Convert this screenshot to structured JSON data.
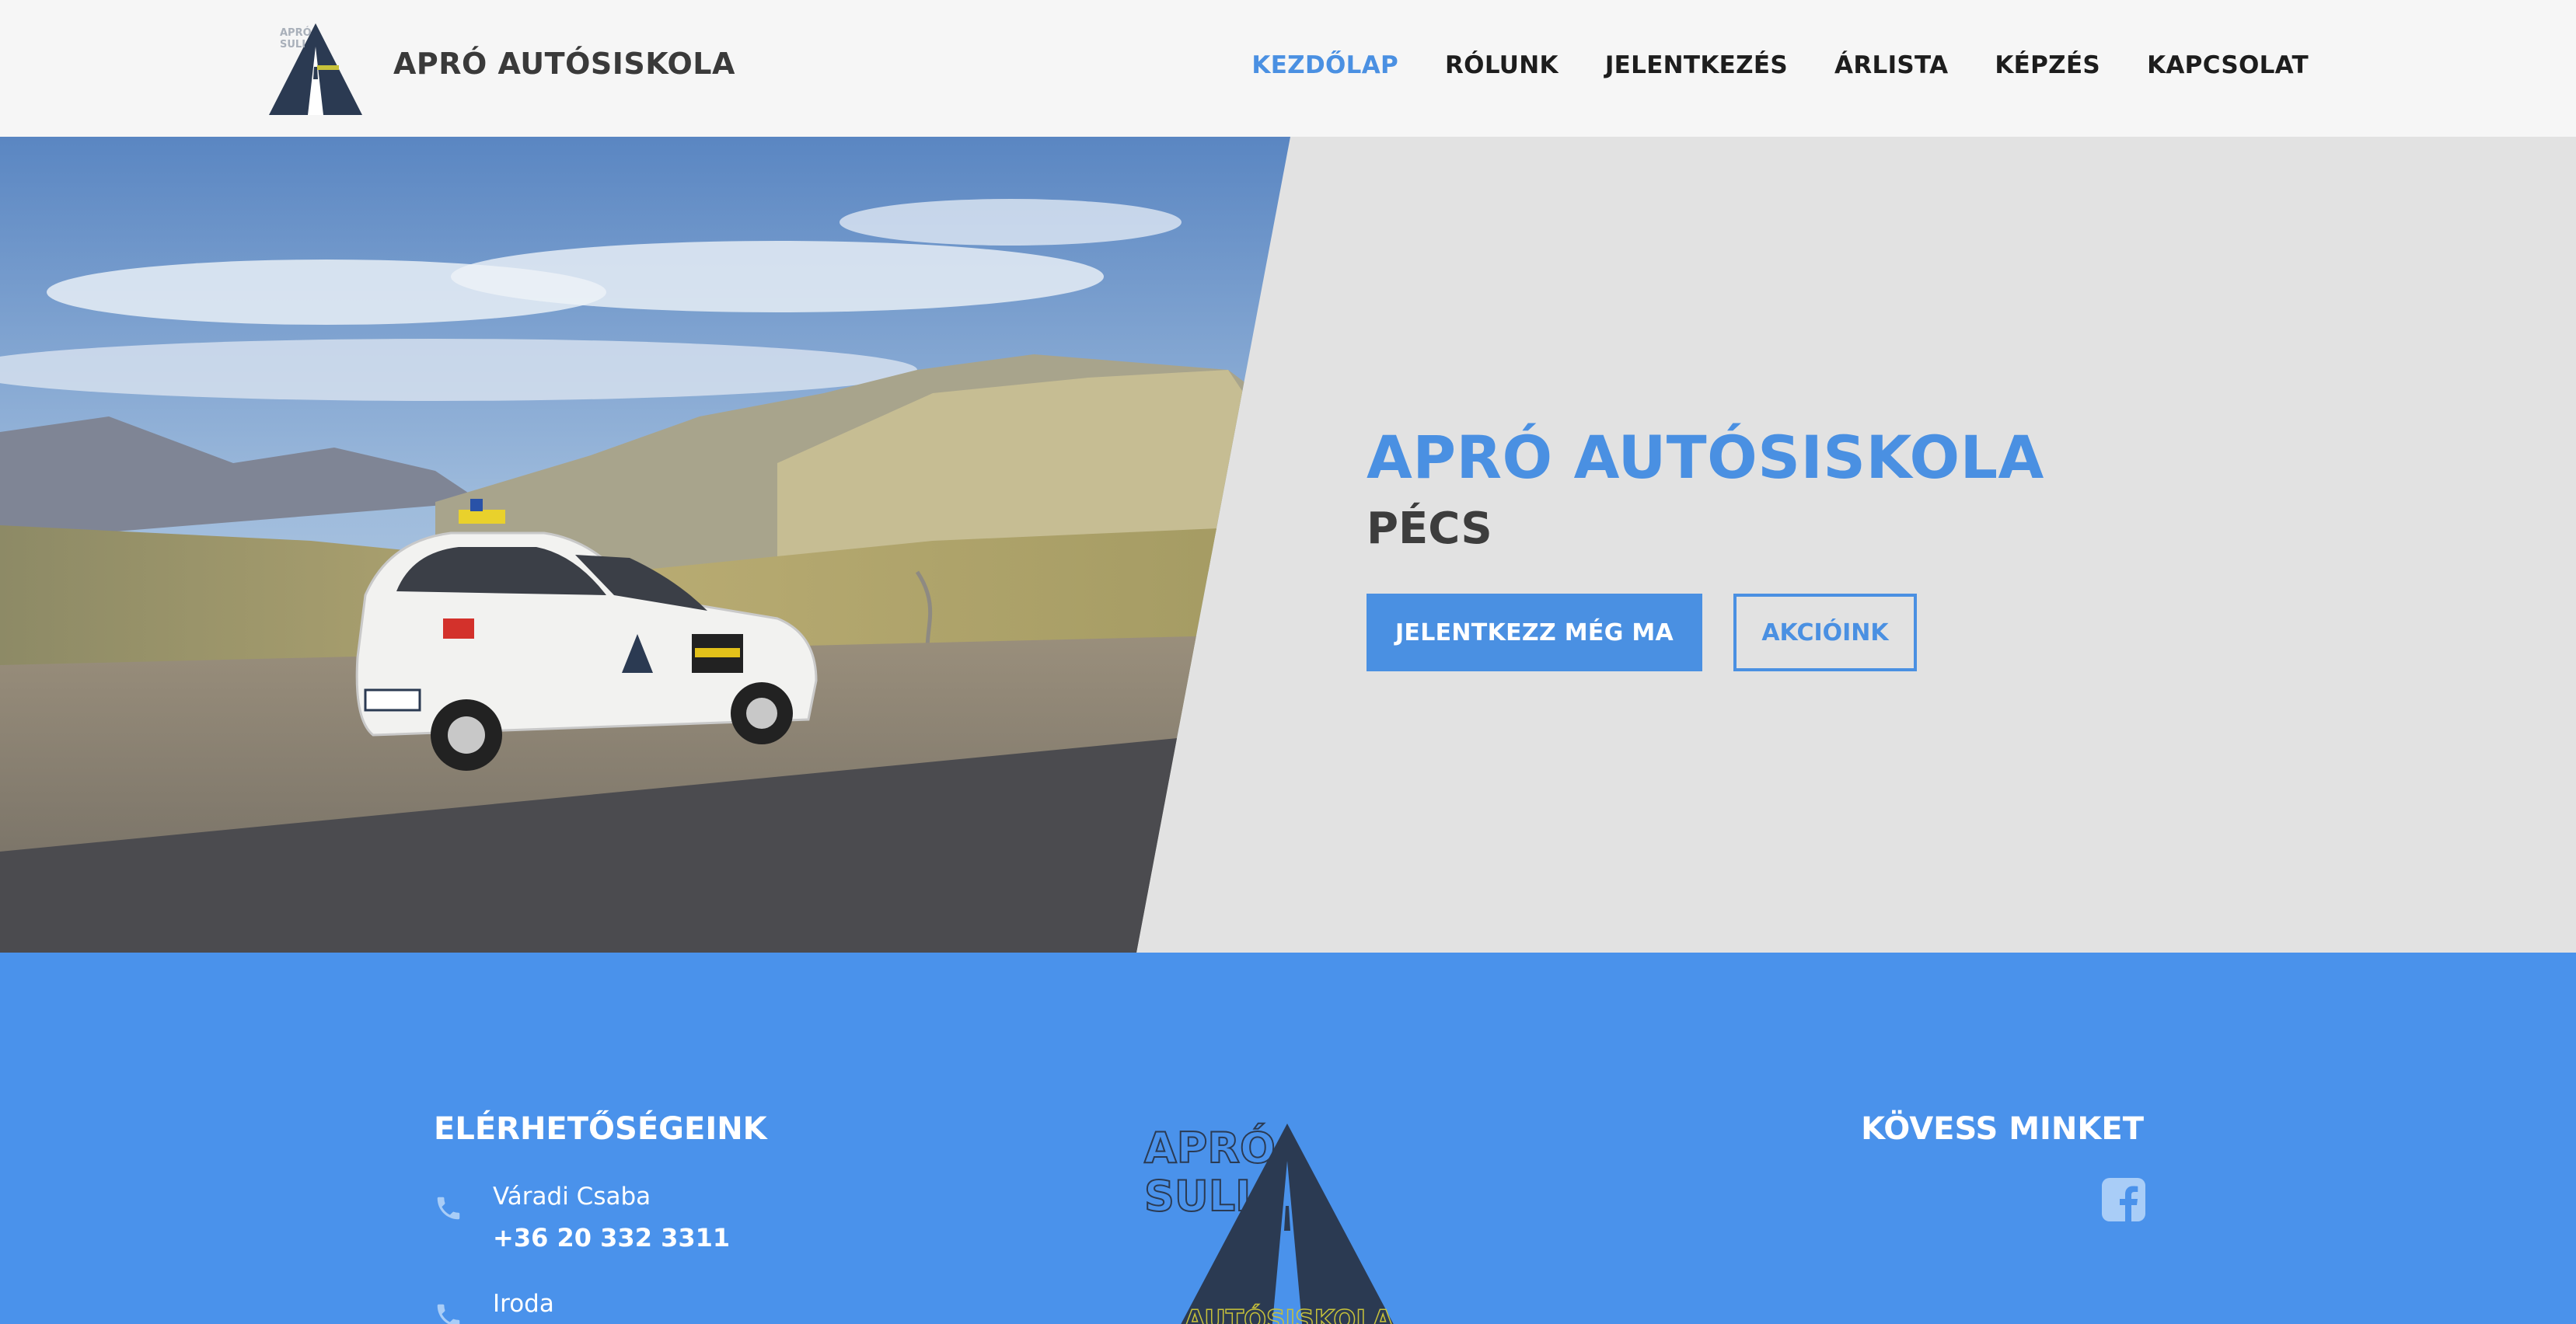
{
  "header": {
    "brand_name": "APRÓ AUTÓSISKOLA",
    "logo_text": [
      "APRÓ",
      "SULI"
    ],
    "nav": [
      {
        "label": "KEZDŐLAP",
        "active": true
      },
      {
        "label": "RÓLUNK",
        "active": false
      },
      {
        "label": "JELENTKEZÉS",
        "active": false
      },
      {
        "label": "ÁRLISTA",
        "active": false
      },
      {
        "label": "KÉPZÉS",
        "active": false
      },
      {
        "label": "KAPCSOLAT",
        "active": false
      }
    ]
  },
  "hero": {
    "title": "APRÓ AUTÓSISKOLA",
    "subtitle": "PÉCS",
    "primary_button": "JELENTKEZZ MÉG MA",
    "secondary_button": "AKCIÓINK",
    "photo_description_icon": "driving-school-car-mountain-photo"
  },
  "footer": {
    "contact_heading": "ELÉRHETŐSÉGEINK",
    "contacts": [
      {
        "name": "Váradi Csaba",
        "phone": "+36 20 332 3311",
        "icon": "phone-icon"
      },
      {
        "name": "Iroda",
        "phone": "",
        "icon": "phone-icon"
      }
    ],
    "logo_text": [
      "APRÓ",
      "SULI",
      "AUTÓSISKOLA"
    ],
    "follow_heading": "KÖVESS MINKET",
    "social_icon": "facebook-icon"
  },
  "colors": {
    "accent": "#4a90e2",
    "footer_bg": "#4a92eb",
    "header_bg": "#f6f6f6",
    "hero_bg": "#e2e2e2",
    "logo_dark": "#2b3a52",
    "logo_yellow": "#c8c23a"
  }
}
